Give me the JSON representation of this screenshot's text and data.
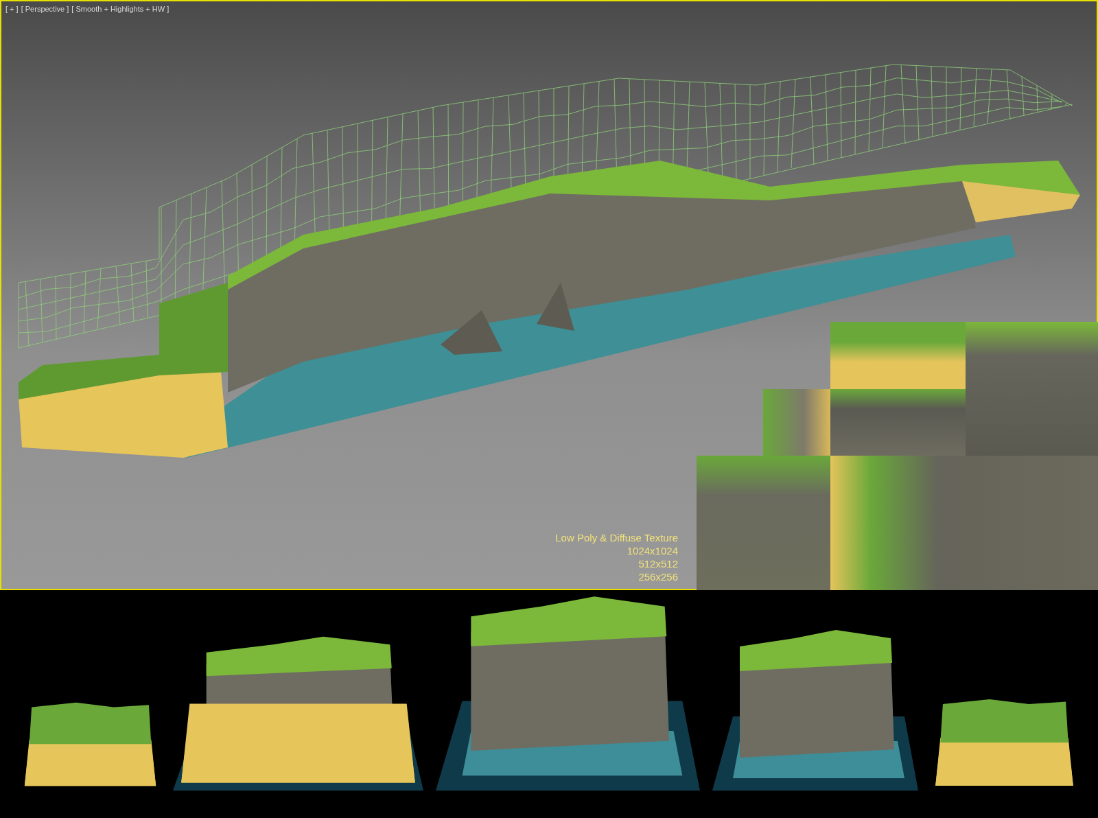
{
  "viewport": {
    "labels": [
      {
        "text": "[ + ]"
      },
      {
        "text": "[ Perspective ]"
      },
      {
        "text": "[ Smooth + Highlights + HW ]"
      }
    ],
    "caption": [
      "Low Poly & Diffuse Texture",
      "1024x1024",
      "512x512",
      "256x256"
    ]
  }
}
